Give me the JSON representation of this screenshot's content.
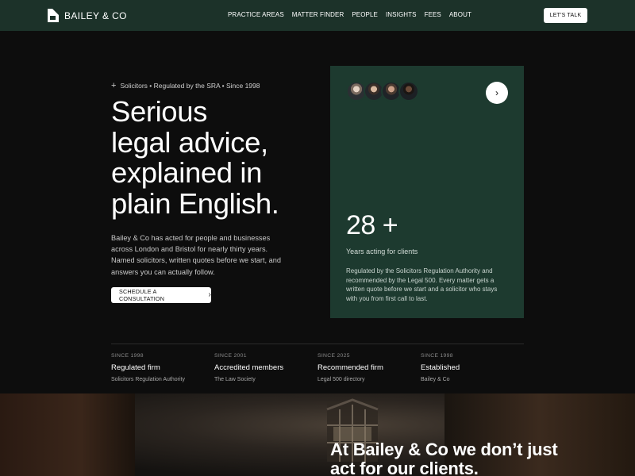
{
  "nav": {
    "brand": "BAILEY & CO",
    "items": [
      "PRACTICE AREAS",
      "MATTER FINDER",
      "PEOPLE",
      "INSIGHTS",
      "FEES",
      "ABOUT"
    ],
    "cta": "LET'S TALK"
  },
  "hero": {
    "eyebrow": "Solicitors • Regulated by the SRA • Since 1998",
    "headline": [
      "Serious",
      "legal advice,",
      "explained in",
      "plain English."
    ],
    "intro": "Bailey & Co has acted for people and businesses across London and Bristol for nearly thirty years. Named solicitors, written quotes before we start, and answers you can actually follow.",
    "cta": "SCHEDULE A CONSULTATION"
  },
  "card": {
    "stat": "28 +",
    "stat_label": "Years acting for clients",
    "description": "Regulated by the Solicitors Regulation Authority and recommended by the Legal 500. Every matter gets a written quote before we start and a solicitor who stays with you from first call to last."
  },
  "credentials": [
    {
      "since": "SINCE 1998",
      "title": "Regulated firm",
      "sub": "Solicitors Regulation Authority"
    },
    {
      "since": "SINCE 2001",
      "title": "Accredited members",
      "sub": "The Law Society"
    },
    {
      "since": "SINCE 2025",
      "title": "Recommended firm",
      "sub": "Legal 500 directory"
    },
    {
      "since": "SINCE 1998",
      "title": "Established",
      "sub": "Bailey & Co"
    }
  ],
  "about": {
    "heading": "At Bailey & Co we don’t just act for our clients."
  },
  "colors": {
    "nav_bg": "#1c3229",
    "card_bg": "#1d3a2f",
    "page_bg": "#0d0d0d"
  },
  "icons": [
    "logo-mark",
    "plus-icon",
    "chevron-right-icon",
    "arrow-right-icon"
  ]
}
